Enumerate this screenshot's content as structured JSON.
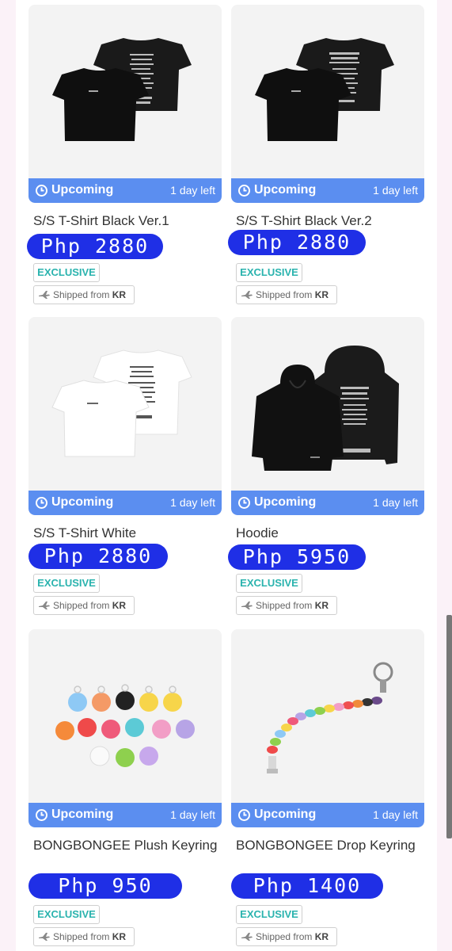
{
  "colors": {
    "accent_blue": "#5b8ef0",
    "price_blue": "#1f2fe6",
    "exclusive_teal": "#2ab3ae"
  },
  "products": [
    {
      "name": "S/S T-Shirt Black Ver.1",
      "price": "Php 2880",
      "status": "Upcoming",
      "time_left": "1 day left",
      "badge": "EXCLUSIVE",
      "shipped_prefix": "Shipped from",
      "shipped_country": "KR",
      "image": "black-tshirt-front-back"
    },
    {
      "name": "S/S T-Shirt Black Ver.2",
      "price": "Php 2880",
      "status": "Upcoming",
      "time_left": "1 day left",
      "badge": "EXCLUSIVE",
      "shipped_prefix": "Shipped from",
      "shipped_country": "KR",
      "image": "black-tshirt-front-back"
    },
    {
      "name": "S/S T-Shirt White",
      "price": "Php 2880",
      "status": "Upcoming",
      "time_left": "1 day left",
      "badge": "EXCLUSIVE",
      "shipped_prefix": "Shipped from",
      "shipped_country": "KR",
      "image": "white-tshirt-front-back"
    },
    {
      "name": "Hoodie",
      "price": "Php 5950",
      "status": "Upcoming",
      "time_left": "1 day left",
      "badge": "EXCLUSIVE",
      "shipped_prefix": "Shipped from",
      "shipped_country": "KR",
      "image": "black-hoodie-front-back"
    },
    {
      "name": "BONGBONGEE Plush Keyring",
      "price": "Php 950",
      "status": "Upcoming",
      "time_left": "1 day left",
      "badge": "EXCLUSIVE",
      "shipped_prefix": "Shipped from",
      "shipped_country": "KR",
      "image": "plush-keyrings"
    },
    {
      "name": "BONGBONGEE Drop Keyring",
      "price": "Php 1400",
      "status": "Upcoming",
      "time_left": "1 day left",
      "badge": "EXCLUSIVE",
      "shipped_prefix": "Shipped from",
      "shipped_country": "KR",
      "image": "drop-keyring-strap"
    }
  ]
}
